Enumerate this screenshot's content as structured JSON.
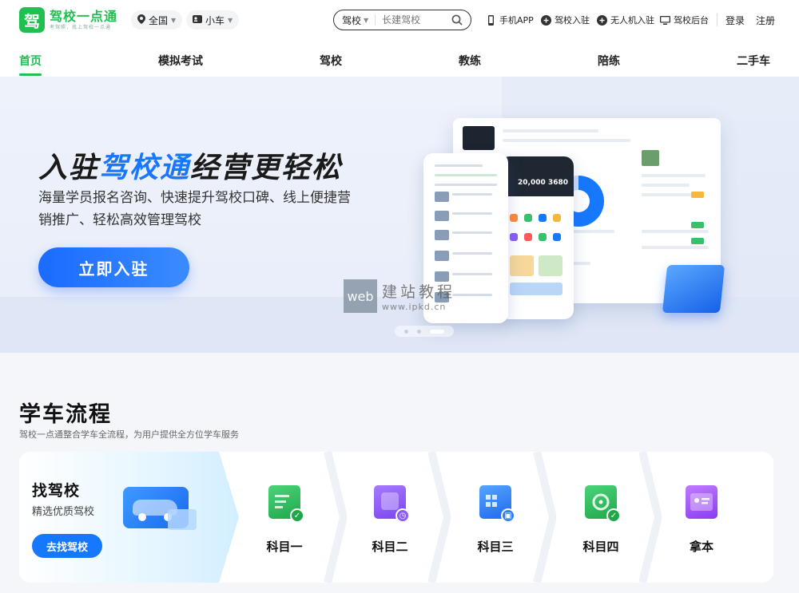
{
  "header": {
    "logo_mark": "驾",
    "logo_name": "驾校一点通",
    "logo_slogan": "考驾照，找上驾校一点通",
    "region": "全国",
    "vehicle": "小车",
    "search": {
      "category": "驾校",
      "placeholder": "长建驾校"
    },
    "links": [
      {
        "label": "手机APP",
        "icon": "phone-icon"
      },
      {
        "label": "驾校入驻",
        "icon": "plus-circle-icon"
      },
      {
        "label": "无人机入驻",
        "icon": "plus-circle-icon"
      },
      {
        "label": "驾校后台",
        "icon": "monitor-icon"
      }
    ],
    "login": "登录",
    "register": "注册"
  },
  "nav": {
    "items": [
      "首页",
      "模拟考试",
      "驾校",
      "教练",
      "陪练",
      "二手车"
    ],
    "active_index": 0
  },
  "hero": {
    "title_pre": "入驻",
    "title_highlight": "驾校通",
    "title_post": "经营更轻松",
    "description": "海量学员报名咨询、快速提升驾校口碑、线上便捷营销推广、轻松高效管理驾校",
    "cta": "立即入驻",
    "phone_stats": [
      "20,000",
      "3680"
    ],
    "carousel": {
      "count": 3,
      "active_index": 2
    }
  },
  "watermark": {
    "box_text": "web",
    "cn_text": "建站教程",
    "url": "www.ipkd.cn"
  },
  "process": {
    "title": "学车流程",
    "subtitle": "驾校一点通整合学车全流程，为用户提供全方位学车服务",
    "first": {
      "title": "找驾校",
      "subtitle": "精选优质驾校",
      "button": "去找驾校"
    },
    "steps": [
      {
        "label": "科目一",
        "icon": "document-check-icon",
        "color": "#22b455"
      },
      {
        "label": "科目二",
        "icon": "clock-card-icon",
        "color": "#8b5cf6"
      },
      {
        "label": "科目三",
        "icon": "building-car-icon",
        "color": "#2f7cf6"
      },
      {
        "label": "科目四",
        "icon": "steering-wheel-icon",
        "color": "#22b455"
      },
      {
        "label": "拿本",
        "icon": "license-card-icon",
        "color": "#8b5cf6"
      }
    ]
  },
  "colors": {
    "brand_green": "#1fbf52",
    "accent_blue": "#1677ff"
  }
}
